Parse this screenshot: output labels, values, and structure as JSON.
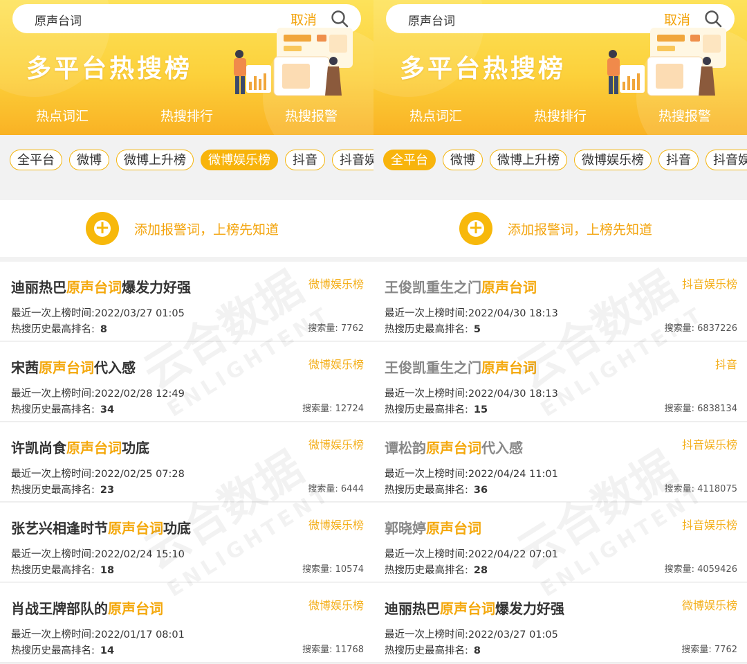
{
  "screens": [
    {
      "search": {
        "value": "原声台词",
        "cancel": "取消"
      },
      "banner_title": "多平台热搜榜",
      "header_tabs": [
        "热点词汇",
        "热搜排行",
        "热搜报警"
      ],
      "chips": [
        "全平台",
        "微博",
        "微博上升榜",
        "微博娱乐榜",
        "抖音",
        "抖音娱"
      ],
      "active_chip": 3,
      "add_alert": "添加报警词，上榜先知道",
      "watermark": "云合数据",
      "items": [
        {
          "pre": "迪丽热巴",
          "hl": "原声台词",
          "post": "爆发力好强",
          "dim": false,
          "source": "微博娱乐榜",
          "time": "最近一次上榜时间:2022/03/27 01:05",
          "rank_label": "热搜历史最高排名:",
          "rank": "8",
          "count": "搜索量: 7762"
        },
        {
          "pre": "宋茜",
          "hl": "原声台词",
          "post": "代入感",
          "dim": false,
          "source": "微博娱乐榜",
          "time": "最近一次上榜时间:2022/02/28 12:49",
          "rank_label": "热搜历史最高排名:",
          "rank": "34",
          "count": "搜索量: 12724"
        },
        {
          "pre": "许凯尚食",
          "hl": "原声台词",
          "post": "功底",
          "dim": false,
          "source": "微博娱乐榜",
          "time": "最近一次上榜时间:2022/02/25 07:28",
          "rank_label": "热搜历史最高排名:",
          "rank": "23",
          "count": "搜索量: 6444"
        },
        {
          "pre": "张艺兴相逢时节",
          "hl": "原声台词",
          "post": "功底",
          "dim": false,
          "source": "微博娱乐榜",
          "time": "最近一次上榜时间:2022/02/24 15:10",
          "rank_label": "热搜历史最高排名:",
          "rank": "18",
          "count": "搜索量: 10574"
        },
        {
          "pre": "肖战王牌部队的",
          "hl": "原声台词",
          "post": "",
          "dim": false,
          "source": "微博娱乐榜",
          "time": "最近一次上榜时间:2022/01/17 08:01",
          "rank_label": "热搜历史最高排名:",
          "rank": "14",
          "count": "搜索量: 11768"
        }
      ]
    },
    {
      "search": {
        "value": "原声台词",
        "cancel": "取消"
      },
      "banner_title": "多平台热搜榜",
      "header_tabs": [
        "热点词汇",
        "热搜排行",
        "热搜报警"
      ],
      "chips": [
        "全平台",
        "微博",
        "微博上升榜",
        "微博娱乐榜",
        "抖音",
        "抖音娱"
      ],
      "active_chip": 0,
      "add_alert": "添加报警词，上榜先知道",
      "watermark": "云合数据",
      "items": [
        {
          "pre": "王俊凯重生之门",
          "hl": "原声台词",
          "post": "",
          "dim": true,
          "source": "抖音娱乐榜",
          "time": "最近一次上榜时间:2022/04/30 18:13",
          "rank_label": "热搜历史最高排名:",
          "rank": "5",
          "count": "搜索量: 6837226"
        },
        {
          "pre": "王俊凯重生之门",
          "hl": "原声台词",
          "post": "",
          "dim": true,
          "source": "抖音",
          "time": "最近一次上榜时间:2022/04/30 18:13",
          "rank_label": "热搜历史最高排名:",
          "rank": "15",
          "count": "搜索量: 6838134"
        },
        {
          "pre": "谭松韵",
          "hl": "原声台词",
          "post": "代入感",
          "dim": true,
          "source": "抖音娱乐榜",
          "time": "最近一次上榜时间:2022/04/24 11:01",
          "rank_label": "热搜历史最高排名:",
          "rank": "36",
          "count": "搜索量: 4118075"
        },
        {
          "pre": "郭晓婷",
          "hl": "原声台词",
          "post": "",
          "dim": true,
          "source": "抖音娱乐榜",
          "time": "最近一次上榜时间:2022/04/22 07:01",
          "rank_label": "热搜历史最高排名:",
          "rank": "28",
          "count": "搜索量: 4059426"
        },
        {
          "pre": "迪丽热巴",
          "hl": "原声台词",
          "post": "爆发力好强",
          "dim": false,
          "source": "微博娱乐榜",
          "time": "最近一次上榜时间:2022/03/27 01:05",
          "rank_label": "热搜历史最高排名:",
          "rank": "8",
          "count": "搜索量: 7762"
        }
      ]
    }
  ]
}
